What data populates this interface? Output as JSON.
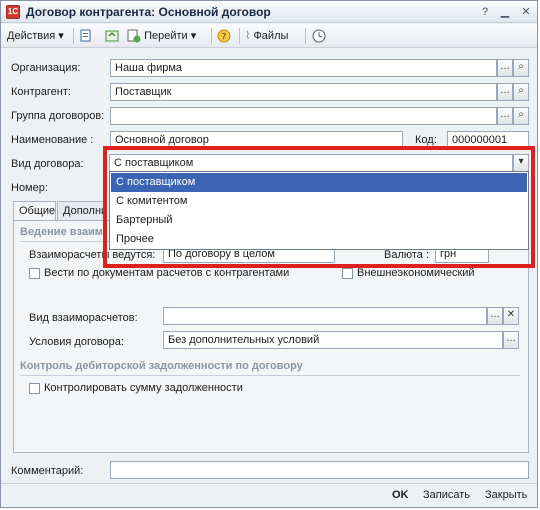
{
  "window": {
    "title": "Договор контрагента: Основной договор"
  },
  "toolbar": {
    "actions": "Действия",
    "goto": "Перейти",
    "files": "Файлы"
  },
  "form": {
    "org_label": "Организация:",
    "org_value": "Наша фирма",
    "contractor_label": "Контрагент:",
    "contractor_value": "Поставщик",
    "group_label": "Группа договоров:",
    "group_value": "",
    "name_label": "Наименование :",
    "name_value": "Основной договор",
    "code_label": "Код:",
    "code_value": "000000001",
    "type_label": "Вид договора:",
    "type_value": "С поставщиком",
    "number_label": "Номер:"
  },
  "dropdown": {
    "options": [
      "С поставщиком",
      "С комитентом",
      "Бартерный",
      "Прочее"
    ]
  },
  "tabs": {
    "general": "Общие",
    "additional": "Дополни"
  },
  "general": {
    "section_settlements": "Ведение взаим",
    "settlements_label": "Взаиморасчеты ведутся:",
    "settlements_value": "По договору в целом",
    "currency_label": "Валюта :",
    "currency_value": "грн",
    "by_docs_label": "Вести по документам расчетов с контрагентами",
    "foreign_label": "Внешнеэкономический",
    "settlement_type_label": "Вид взаиморасчетов:",
    "settlement_type_value": "",
    "conditions_label": "Условия договора:",
    "conditions_value": "Без дополнительных условий",
    "section_debt": "Контроль дебиторской задолженности по договору",
    "control_debt_label": "Контролировать сумму задолженности"
  },
  "comment": {
    "label": "Комментарий:",
    "value": ""
  },
  "footer": {
    "ok": "OK",
    "save": "Записать",
    "close": "Закрыть"
  }
}
